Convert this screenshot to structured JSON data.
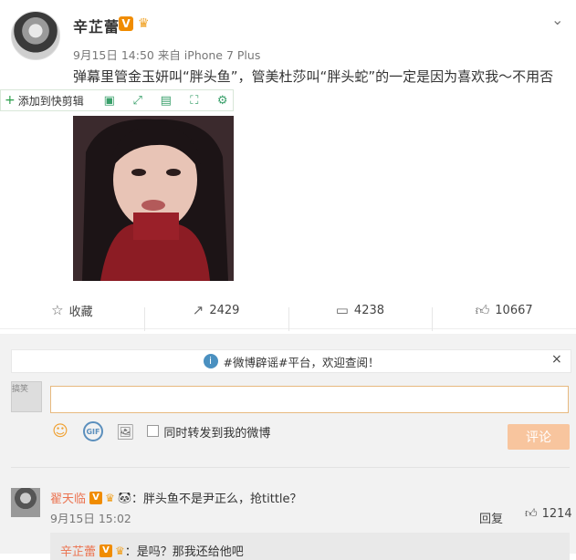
{
  "post": {
    "author": "辛芷蕾",
    "verified_badge": "V",
    "timestamp": "9月15日 14:50 来自 iPhone 7 Plus",
    "text": "弹幕里管金玉妍叫“胖头鱼”，管美杜莎叫“胖头蛇”的一定是因为喜欢我～不用否",
    "more_icon": "chevron-down-icon"
  },
  "clip_toolbar": {
    "add_label": "添加到快剪辑",
    "icons": [
      "copy-icon",
      "expand-icon",
      "save-icon",
      "crop-icon",
      "settings-icon"
    ]
  },
  "actions": {
    "favorite_label": "收藏",
    "repost_count": "2429",
    "comment_count": "4238",
    "like_count": "10667"
  },
  "notice": {
    "text": "#微博辟谣#平台，欢迎查阅！",
    "close": "×"
  },
  "composer": {
    "avatar_text": "搞笑",
    "repost_checkbox_label": "同时转发到我的微博",
    "submit_label": "评论"
  },
  "comment": {
    "author": "翟天临",
    "badge": "V",
    "body": "：胖头鱼不是尹正么，抢tittle？",
    "time": "9月15日 15:02",
    "reply_label": "回复",
    "like_count": "1214"
  },
  "sub_reply": {
    "author": "辛芷蕾",
    "badge": "V",
    "body": "：是吗？那我还给他吧"
  },
  "colors": {
    "accent": "#eb7350",
    "submit_bg": "#f8c59e",
    "verified": "#f08c00"
  }
}
